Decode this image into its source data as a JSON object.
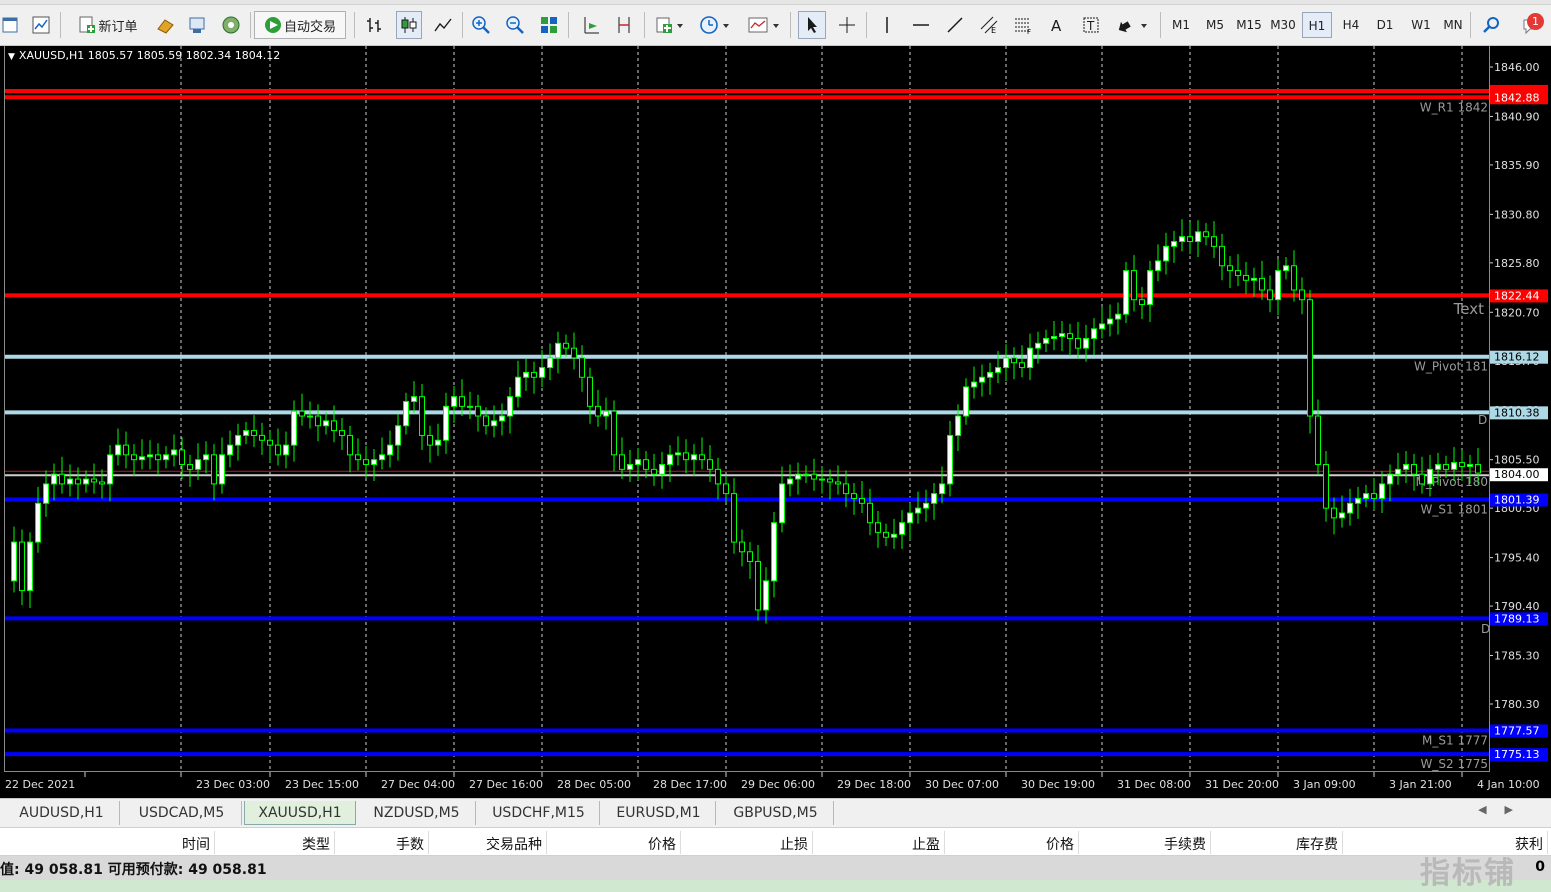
{
  "toolbar": {
    "new_order_label": "新订单",
    "auto_trade_label": "自动交易",
    "timeframes": [
      "M1",
      "M5",
      "M15",
      "M30",
      "H1",
      "H4",
      "D1",
      "W1",
      "MN"
    ],
    "active_timeframe": "H1",
    "notification_count": "1"
  },
  "chart": {
    "symbol_info": "XAUUSD,H1  1805.57 1805.59 1802.34 1804.12",
    "text_label": "Text",
    "price_ticks": [
      "1846.00",
      "1840.90",
      "1835.90",
      "1830.80",
      "1825.80",
      "1820.70",
      "1815.70",
      "1810.60",
      "1805.50",
      "1800.50",
      "1795.40",
      "1790.40",
      "1785.30",
      "1780.30",
      "1775.20"
    ],
    "time_ticks": [
      "22 Dec 2021",
      "23 Dec 03:00",
      "23 Dec 15:00",
      "27 Dec 04:00",
      "27 Dec 16:00",
      "28 Dec 05:00",
      "28 Dec 17:00",
      "29 Dec 06:00",
      "29 Dec 18:00",
      "30 Dec 07:00",
      "30 Dec 19:00",
      "31 Dec 08:00",
      "31 Dec 20:00",
      "3 Jan 09:00",
      "3 Jan 21:00",
      "4 Jan 10:00"
    ],
    "levels": [
      {
        "price": 1843.53,
        "label": "1843.53",
        "color": "#ff0000",
        "bg": "#ff0000",
        "fg": "#ff0000",
        "name": ""
      },
      {
        "price": 1842.88,
        "label": "1842.88",
        "color": "#ff0000",
        "bg": "#ff0000",
        "fg": "#ffffff",
        "name": "W_R1 1842"
      },
      {
        "price": 1822.44,
        "label": "1822.44",
        "color": "#ff0000",
        "bg": "#ff0000",
        "fg": "#ffffff",
        "name": ""
      },
      {
        "price": 1816.12,
        "label": "1816.12",
        "color": "#add8e6",
        "bg": "#add8e6",
        "fg": "#000000",
        "name": "W_Pivot 181"
      },
      {
        "price": 1810.38,
        "label": "1810.38",
        "color": "#add8e6",
        "bg": "#add8e6",
        "fg": "#000000",
        "name": ""
      },
      {
        "price": 1801.39,
        "label": "1801.39",
        "color": "#0000ff",
        "bg": "#0000ff",
        "fg": "#ffffff",
        "name": "W_S1 1801"
      },
      {
        "price": 1789.13,
        "label": "1789.13",
        "color": "#0000ff",
        "bg": "#0000ff",
        "fg": "#ffffff",
        "name": ""
      },
      {
        "price": 1777.57,
        "label": "1777.57",
        "color": "#0000ff",
        "bg": "#0000ff",
        "fg": "#ffffff",
        "name": "M_S1 1777"
      },
      {
        "price": 1775.13,
        "label": "1775.13",
        "color": "#0000ff",
        "bg": "#0000ff",
        "fg": "#ffffff",
        "name": "W_S2 1775"
      }
    ],
    "current_price": {
      "price": 1804.0,
      "label": "1804.00"
    },
    "pivot_label": "M_Pivot 180",
    "d_marks": [
      "D",
      "D"
    ],
    "colors": {
      "bull": "#ffffff",
      "bear": "#000000",
      "wick": "#00ff00",
      "grid": "#c8c8c8"
    }
  },
  "tabs": [
    "AUDUSD,H1",
    "USDCAD,M5",
    "XAUUSD,H1",
    "NZDUSD,M5",
    "USDCHF,M15",
    "EURUSD,M1",
    "GBPUSD,M5"
  ],
  "active_tab": "XAUUSD,H1",
  "terminal": {
    "columns": [
      "时间",
      "类型",
      "手数",
      "交易品种",
      "价格",
      "止损",
      "止盈",
      "价格",
      "手续费",
      "库存费",
      "获利"
    ],
    "balance_text": "值: 49 058.81  可用预付款: 49 058.81",
    "balance_tail": "0"
  },
  "watermark": "指标铺"
}
